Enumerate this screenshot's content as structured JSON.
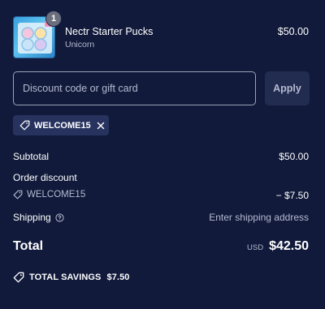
{
  "product": {
    "quantity": "1",
    "name": "Nectr Starter Pucks",
    "variant": "Unicorn",
    "price": "$50.00"
  },
  "discount": {
    "placeholder": "Discount code or gift card",
    "apply_label": "Apply",
    "applied_code": "WELCOME15"
  },
  "summary": {
    "subtotal_label": "Subtotal",
    "subtotal_value": "$50.00",
    "order_discount_label": "Order discount",
    "discount_code": "WELCOME15",
    "discount_value": "− $7.50",
    "shipping_label": "Shipping",
    "shipping_value": "Enter shipping address",
    "total_label": "Total",
    "currency": "USD",
    "total_value": "$42.50",
    "savings_label": "TOTAL SAVINGS",
    "savings_value": "$7.50"
  },
  "icons": {
    "tag": "tag-icon",
    "close": "close-icon",
    "info": "info-icon"
  },
  "colors": {
    "background": "#111a3b",
    "chip": "#27335e",
    "button": "#222c50",
    "muted_text": "#b5bad0"
  }
}
